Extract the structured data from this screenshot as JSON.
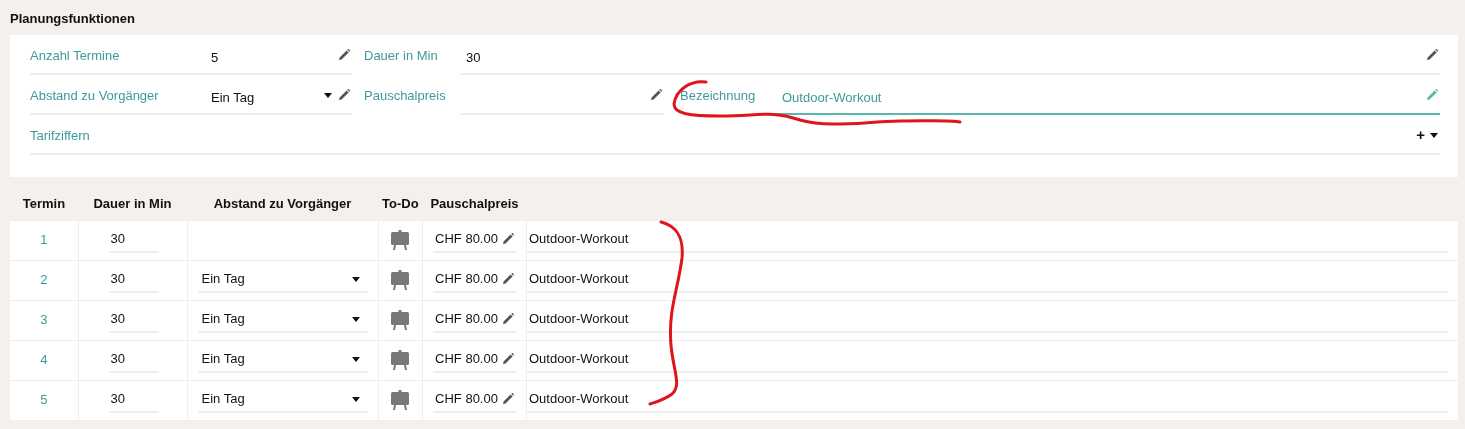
{
  "section_title": "Planungsfunktionen",
  "form_rows": [
    [
      {
        "label": "Anzahl Termine",
        "value": "5",
        "kind": "text"
      },
      {
        "label": "Dauer in Min",
        "value": "30",
        "kind": "text"
      }
    ],
    [
      {
        "label": "Abstand zu Vorgänger",
        "value": "Ein Tag",
        "kind": "select"
      },
      {
        "label": "Pauschalpreis",
        "kind": "text"
      },
      {
        "label": "Bezeichnung",
        "value": "Outdoor-Workout",
        "kind": "text",
        "focused": true
      }
    ],
    [
      {
        "label": "Tarifziffern",
        "kind": "add",
        "add_symbol": "+"
      }
    ]
  ],
  "table": {
    "columns": [
      "Termin",
      "Dauer in Min",
      "Abstand zu Vorgänger",
      "To-Do",
      "Pauschalpreis"
    ],
    "rows": [
      {
        "termin": "1",
        "dauer": "30",
        "preis": "CHF 80.00",
        "bezeichnung": "Outdoor-Workout"
      },
      {
        "termin": "2",
        "dauer": "30",
        "abstand": "Ein Tag",
        "preis": "CHF 80.00",
        "bezeichnung": "Outdoor-Workout"
      },
      {
        "termin": "3",
        "dauer": "30",
        "abstand": "Ein Tag",
        "preis": "CHF 80.00",
        "bezeichnung": "Outdoor-Workout"
      },
      {
        "termin": "4",
        "dauer": "30",
        "abstand": "Ein Tag",
        "preis": "CHF 80.00",
        "bezeichnung": "Outdoor-Workout"
      },
      {
        "termin": "5",
        "dauer": "30",
        "abstand": "Ein Tag",
        "preis": "CHF 80.00",
        "bezeichnung": "Outdoor-Workout"
      }
    ]
  },
  "annotations": [
    {
      "kind": "underline"
    },
    {
      "kind": "bracket"
    }
  ]
}
